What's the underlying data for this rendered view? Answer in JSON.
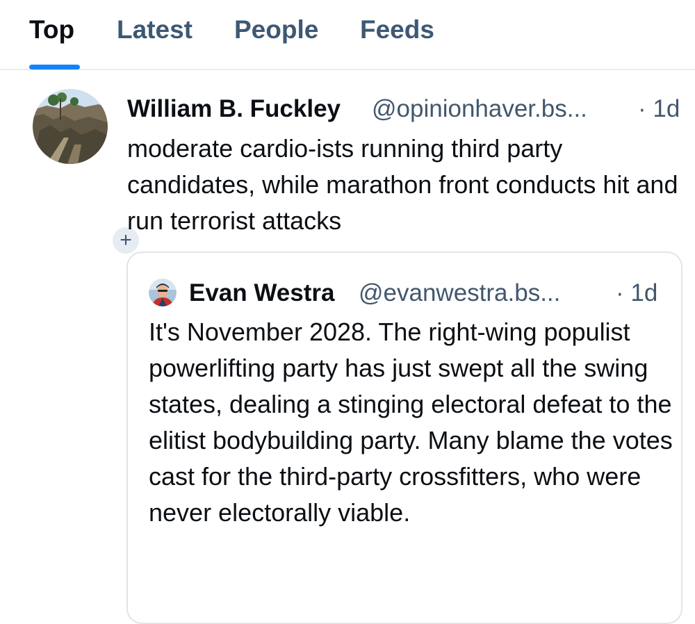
{
  "tabs": [
    {
      "label": "Top",
      "active": true
    },
    {
      "label": "Latest",
      "active": false
    },
    {
      "label": "People",
      "active": false
    },
    {
      "label": "Feeds",
      "active": false
    }
  ],
  "colors": {
    "accent": "#1083fe",
    "muted_text": "#42576c",
    "tab_inactive": "#3e5874",
    "border": "#dfe5eb"
  },
  "post": {
    "display_name": "William B. Fuckley",
    "handle": "@opinionhaver.bs...",
    "time": "· 1d",
    "text": "moderate cardio-ists running third party candidates, while marathon front conducts hit and run terrorist attacks",
    "follow_icon": "plus-icon"
  },
  "quote": {
    "display_name": "Evan Westra",
    "handle": "@evanwestra.bs...",
    "time": "· 1d",
    "text": "It's November 2028. The right-wing populist powerlifting party has just swept all the swing states, dealing a stinging electoral defeat to the elitist bodybuilding party. Many blame the votes cast for the third-party crossfitters, who were never electorally viable."
  }
}
